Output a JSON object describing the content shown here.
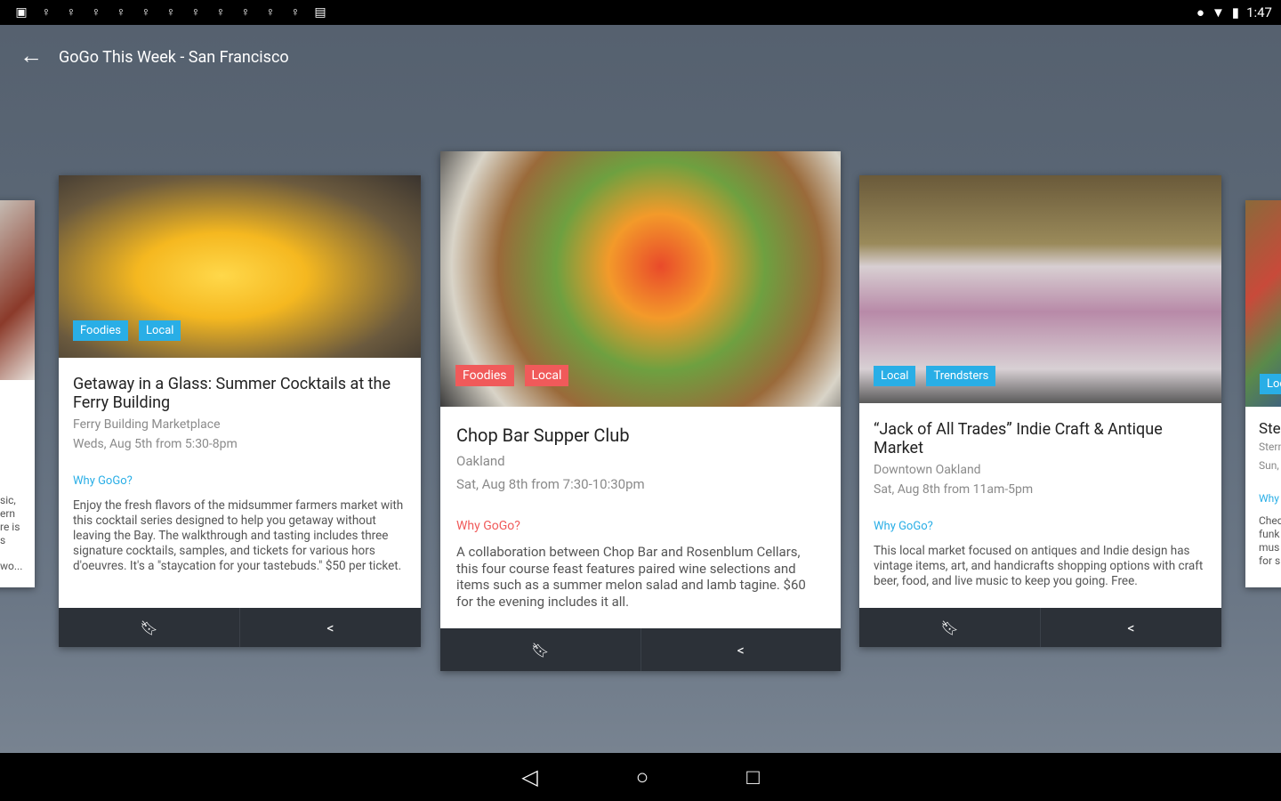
{
  "status_bar": {
    "time": "1:47",
    "notification_icons": [
      "image-icon",
      "location-pin-icon",
      "location-pin-icon",
      "location-pin-icon",
      "location-pin-icon",
      "location-pin-icon",
      "location-pin-icon",
      "location-pin-icon",
      "location-pin-icon",
      "location-pin-icon",
      "location-pin-icon",
      "location-pin-icon",
      "briefcase-icon"
    ]
  },
  "app_bar": {
    "title": "GoGo This Week - San Francisco"
  },
  "colors": {
    "blue_tag": "#29aee6",
    "red_tag": "#f05a5a"
  },
  "left_partial": {
    "lines": [
      "sic,",
      "ern",
      "re is",
      "s",
      "wo..."
    ]
  },
  "cards": [
    {
      "tags": [
        "Foodies",
        "Local"
      ],
      "title": "Getaway in a Glass: Summer Cocktails at the Ferry Building",
      "venue": "Ferry Building Marketplace",
      "date": "Weds, Aug 5th from 5:30-8pm",
      "why": "Why GoGo?",
      "description": "Enjoy the fresh flavors of the midsummer farmers market with this cocktail series designed to help you getaway without leaving the Bay. The walkthrough and tasting includes three signature cocktails, samples, and tickets for various hors d'oeuvres. It's a \"staycation for your tastebuds.\" $50 per ticket."
    },
    {
      "tags": [
        "Foodies",
        "Local"
      ],
      "title": "Chop Bar Supper Club",
      "venue": "Oakland",
      "date": "Sat, Aug 8th from 7:30-10:30pm",
      "why": "Why GoGo?",
      "description": "A collaboration between Chop Bar and Rosenblum Cellars, this four course feast features paired wine selections and items such as a summer melon salad and lamb tagine. $60 for the evening includes it all."
    },
    {
      "tags": [
        "Local",
        "Trendsters"
      ],
      "title": "“Jack of All Trades” Indie Craft & Antique Market",
      "venue": "Downtown Oakland",
      "date": "Sat, Aug 8th from 11am-5pm",
      "why": "Why GoGo?",
      "description": "This local market focused on antiques and Indie design has vintage items, art, and handicrafts shopping options with craft beer, food, and live music to keep you going. Free."
    }
  ],
  "right_partial": {
    "tag": "Loc",
    "title": "Ste",
    "venue": "Stern",
    "date": "Sun,",
    "why": "Why",
    "lines": [
      "Chec",
      "funk",
      "mus",
      "for s"
    ]
  }
}
